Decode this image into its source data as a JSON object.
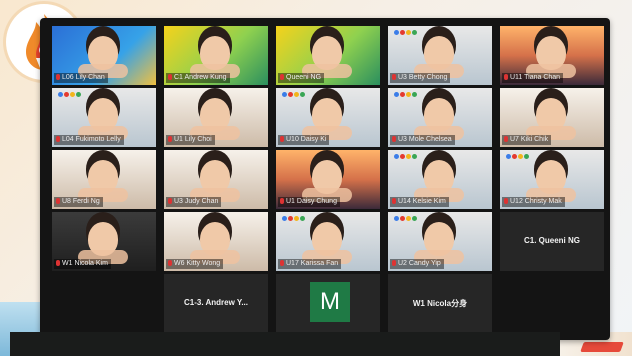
{
  "meeting": {
    "participants": [
      {
        "name": "L06 Lily Chan",
        "scene": "blue"
      },
      {
        "name": "C1 Andrew Kung",
        "scene": "yellow",
        "highlight": true
      },
      {
        "name": "Queeni NG",
        "scene": "yellow"
      },
      {
        "name": "U3 Betty Chong",
        "scene": "dots"
      },
      {
        "name": "U11 Tiana Chan",
        "scene": "sunset"
      },
      {
        "name": "L04 Fukimoto Lelly",
        "scene": "dots"
      },
      {
        "name": "U1 Lily Choi",
        "scene": "room"
      },
      {
        "name": "U10 Daisy Ki",
        "scene": "dots"
      },
      {
        "name": "U3 Mole Chelsea",
        "scene": "dots"
      },
      {
        "name": "U7 Kiki Chik",
        "scene": "room"
      },
      {
        "name": "U8 Ferdi Ng",
        "scene": "room"
      },
      {
        "name": "U3 Judy Chan",
        "scene": "room"
      },
      {
        "name": "U1 Daisy Chung",
        "scene": "sunset"
      },
      {
        "name": "U14 Kelsie Kim",
        "scene": "dots"
      },
      {
        "name": "U12 Christy Mak",
        "scene": "dots"
      },
      {
        "name": "W1 Nicola Kim",
        "scene": "dark"
      },
      {
        "name": "W6 Kitty Wong",
        "scene": "room"
      },
      {
        "name": "U17 Karissa Fan",
        "scene": "dots"
      },
      {
        "name": "U2 Candy Yip",
        "scene": "dots"
      }
    ],
    "name_only_tiles": [
      {
        "label": "C1. Queeni NG"
      },
      {
        "label": "C1-3. Andrew Y..."
      },
      {
        "label": "W1  Nicola分身"
      }
    ],
    "avatar_tile": {
      "letter": "M",
      "color": "#1f7a45"
    }
  },
  "colors": {
    "frame": "#141414",
    "tile": "#2d2d2d",
    "highlight": "#9fd23a",
    "dots": [
      "#3b7de8",
      "#e43a2f",
      "#f3b51b",
      "#3aa655"
    ]
  }
}
